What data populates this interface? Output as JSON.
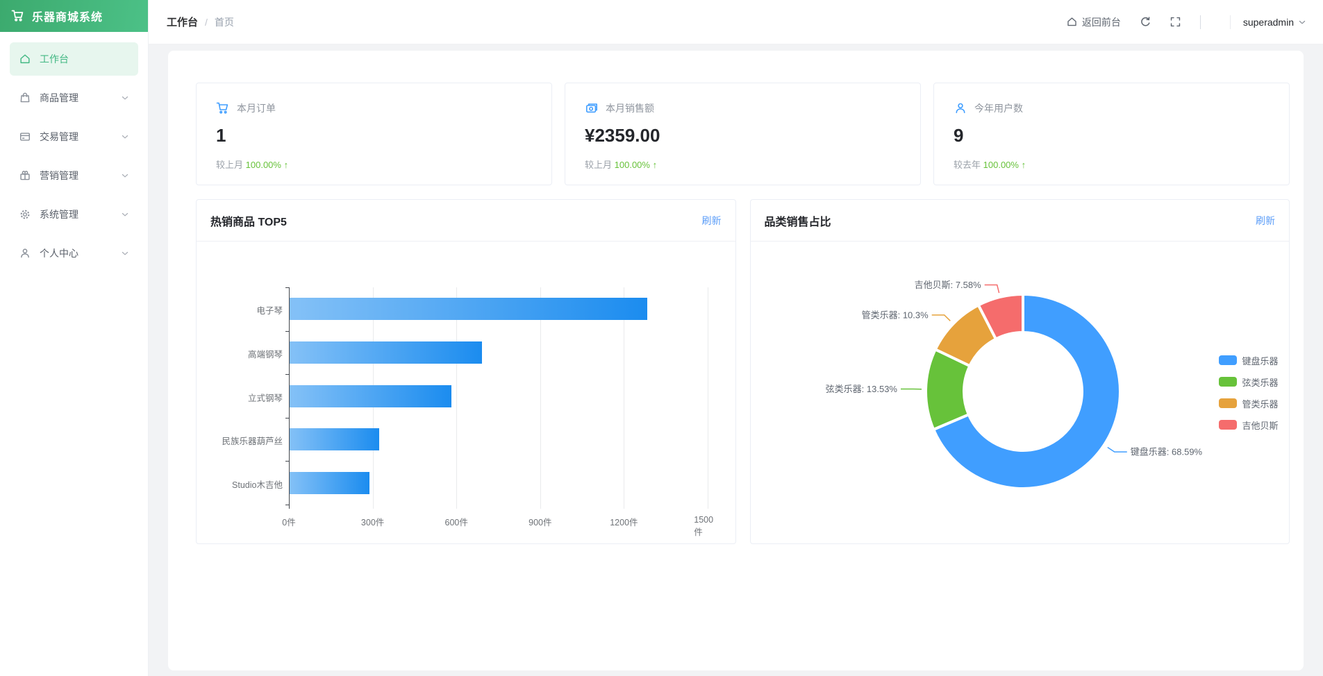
{
  "app": {
    "title": "乐器商城系统"
  },
  "sidebar": {
    "items": [
      {
        "label": "工作台",
        "icon": "home-icon",
        "active": true,
        "expandable": false
      },
      {
        "label": "商品管理",
        "icon": "bag-icon",
        "active": false,
        "expandable": true
      },
      {
        "label": "交易管理",
        "icon": "card-icon",
        "active": false,
        "expandable": true
      },
      {
        "label": "营销管理",
        "icon": "gift-icon",
        "active": false,
        "expandable": true
      },
      {
        "label": "系统管理",
        "icon": "gear-icon",
        "active": false,
        "expandable": true
      },
      {
        "label": "个人中心",
        "icon": "user-icon",
        "active": false,
        "expandable": true
      }
    ]
  },
  "header": {
    "breadcrumb": {
      "current": "工作台",
      "separator": "/",
      "page": "首页"
    },
    "back_to_front": "返回前台",
    "username": "superadmin"
  },
  "stats": [
    {
      "icon": "cart-icon",
      "label": "本月订单",
      "value": "1",
      "compare": "较上月",
      "percent": "100.00%",
      "arrow": "↑"
    },
    {
      "icon": "money-icon",
      "label": "本月销售额",
      "value": "¥2359.00",
      "compare": "较上月",
      "percent": "100.00%",
      "arrow": "↑"
    },
    {
      "icon": "user-icon",
      "label": "今年用户数",
      "value": "9",
      "compare": "较去年",
      "percent": "100.00%",
      "arrow": "↑"
    }
  ],
  "panels": {
    "hot_products": {
      "title": "热销商品 TOP5",
      "refresh": "刷新"
    },
    "category_share": {
      "title": "品类销售占比",
      "refresh": "刷新"
    }
  },
  "colors": {
    "sidebar_green": "#42b883",
    "link_blue": "#5b9df8",
    "up_green": "#67C23A",
    "stat_icon_blue": "#409EFF"
  },
  "chart_data": [
    {
      "type": "bar",
      "orientation": "horizontal",
      "title": "热销商品 TOP5",
      "categories": [
        "电子琴",
        "高端钢琴",
        "立式钢琴",
        "民族乐器葫芦丝",
        "Studio木吉他"
      ],
      "values": [
        1280,
        690,
        580,
        320,
        285
      ],
      "unit": "件",
      "xlim": [
        0,
        1500
      ],
      "x_tick_values": [
        0,
        300,
        600,
        900,
        1200,
        1500
      ],
      "x_tick_labels": [
        "0件",
        "300件",
        "600件",
        "900件",
        "1200件",
        "1500件"
      ],
      "grid": true,
      "bar_gradient": [
        "#84c1f7",
        "#1b8cef"
      ]
    },
    {
      "type": "donut",
      "title": "品类销售占比",
      "start_angle_deg": -90,
      "clockwise": true,
      "inner_radius": 85,
      "outer_radius": 140,
      "slices": [
        {
          "name": "键盘乐器",
          "percent": 68.59,
          "color": "#409EFF"
        },
        {
          "name": "弦类乐器",
          "percent": 13.53,
          "color": "#67C23A"
        },
        {
          "name": "管类乐器",
          "percent": 10.3,
          "color": "#E6A23C"
        },
        {
          "name": "吉他贝斯",
          "percent": 7.58,
          "color": "#F56C6C"
        }
      ],
      "legend": [
        "键盘乐器",
        "弦类乐器",
        "管类乐器",
        "吉他贝斯"
      ],
      "legend_position": "right"
    }
  ]
}
